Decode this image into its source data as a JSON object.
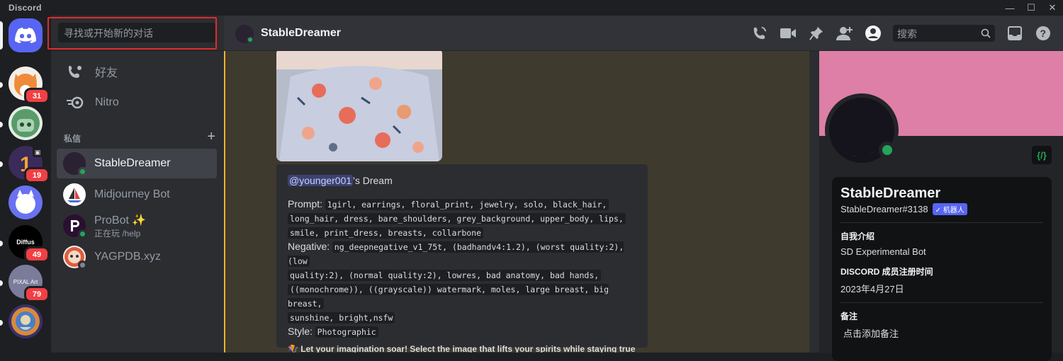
{
  "window": {
    "brand": "Discord",
    "minimize": "—",
    "maximize": "☐",
    "close": "✕"
  },
  "servers": {
    "badges": [
      "31",
      "19",
      "49",
      "79"
    ],
    "diffus_label": "Diffus",
    "pixel_label": "PIXAL Art"
  },
  "dm_panel": {
    "search_placeholder": "寻找或开始新的对话",
    "nav": [
      {
        "label": "好友"
      },
      {
        "label": "Nitro"
      }
    ],
    "section_title": "私信",
    "add": "+",
    "dms": [
      {
        "name": "StableDreamer",
        "sub": ""
      },
      {
        "name": "Midjourney Bot",
        "sub": ""
      },
      {
        "name": "ProBot ✨",
        "sub": "正在玩 /help"
      },
      {
        "name": "YAGPDB.xyz",
        "sub": ""
      }
    ]
  },
  "header": {
    "channel_name": "StableDreamer",
    "search_placeholder": "搜索"
  },
  "embed": {
    "mention": "@younger001",
    "mention_suffix": "'s Dream",
    "prompt_label": "Prompt:",
    "prompt_parts": [
      "1girl, earrings, floral_print, jewelry, solo, black_hair,",
      "long_hair, dress, bare_shoulders, grey_background, upper_body, lips,",
      "smile, print_dress, breasts, collarbone"
    ],
    "negative_label": "Negative:",
    "negative_parts": [
      "ng_deepnegative_v1_75t, (badhandv4:1.2), (worst quality:2), (low",
      "quality:2), (normal quality:2), lowres, bad anatomy, bad hands,",
      "((monochrome)), ((grayscale)) watermark, moles, large breast, big breast,",
      "sunshine, bright,nsfw"
    ],
    "style_label": "Style:",
    "style_value": "Photographic",
    "note": "🪁 Let your imagination soar! Select the image that lifts your spirits while staying true to the prompt! 🫶"
  },
  "profile": {
    "dev_badge": "{/}",
    "name": "StableDreamer",
    "tag": "StableDreamer#3138",
    "bot_badge": "✓ 机器人",
    "about_title": "自我介绍",
    "about_value": "SD Experimental Bot",
    "member_title": "DISCORD 成员注册时间",
    "member_value": "2023年4月27日",
    "note_title": "备注",
    "note_placeholder": "点击添加备注"
  },
  "colors": {
    "blurple": "#5865f2",
    "online": "#23a55a",
    "mention_bar": "#f0b232",
    "banner": "#dd7fa6"
  }
}
